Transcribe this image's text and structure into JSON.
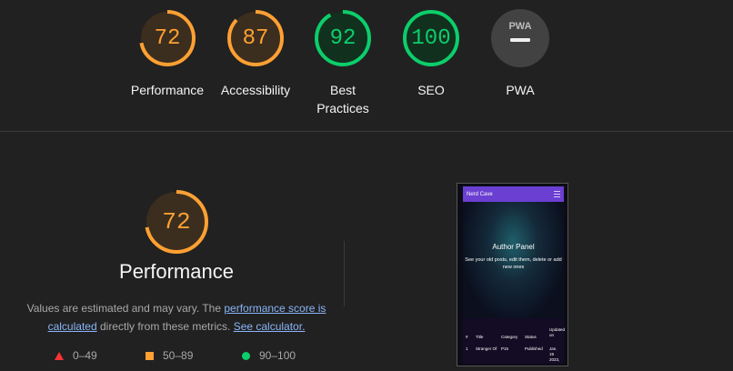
{
  "gauges": [
    {
      "label": "Performance",
      "score": "72",
      "fraction": 0.72,
      "color": "#ffa033"
    },
    {
      "label": "Accessibility",
      "score": "87",
      "fraction": 0.87,
      "color": "#ffa033"
    },
    {
      "label": "Best Practices",
      "score": "92",
      "fraction": 0.92,
      "color": "#0cce6b"
    },
    {
      "label": "SEO",
      "score": "100",
      "fraction": 1.0,
      "color": "#0cce6b"
    },
    {
      "label": "PWA",
      "badge": "PWA",
      "color": "#9e9e9e"
    }
  ],
  "performance": {
    "score": "72",
    "fraction": 0.72,
    "title": "Performance",
    "desc_prefix": "Values are estimated and may vary. The ",
    "desc_link1": "performance score is calculated",
    "desc_middle": " directly from these metrics. ",
    "desc_link2": "See calculator."
  },
  "legend": [
    {
      "icon": "triangle-icon",
      "range": "0–49",
      "color": "#ff3333"
    },
    {
      "icon": "square-icon",
      "range": "50–89",
      "color": "#ffa033"
    },
    {
      "icon": "circle-icon",
      "range": "90–100",
      "color": "#0cce6b"
    }
  ],
  "screenshot": {
    "brand": "Nerd Cave",
    "hero_title": "Author Panel",
    "hero_sub": "See your old posts, edit them, delete or add new ones",
    "table_headers": [
      "#",
      "Title",
      "Category",
      "Status",
      "Updated on"
    ],
    "row": [
      "1",
      "Stranger Of",
      "P15",
      "Published",
      "Jan. 19 2023,"
    ]
  }
}
